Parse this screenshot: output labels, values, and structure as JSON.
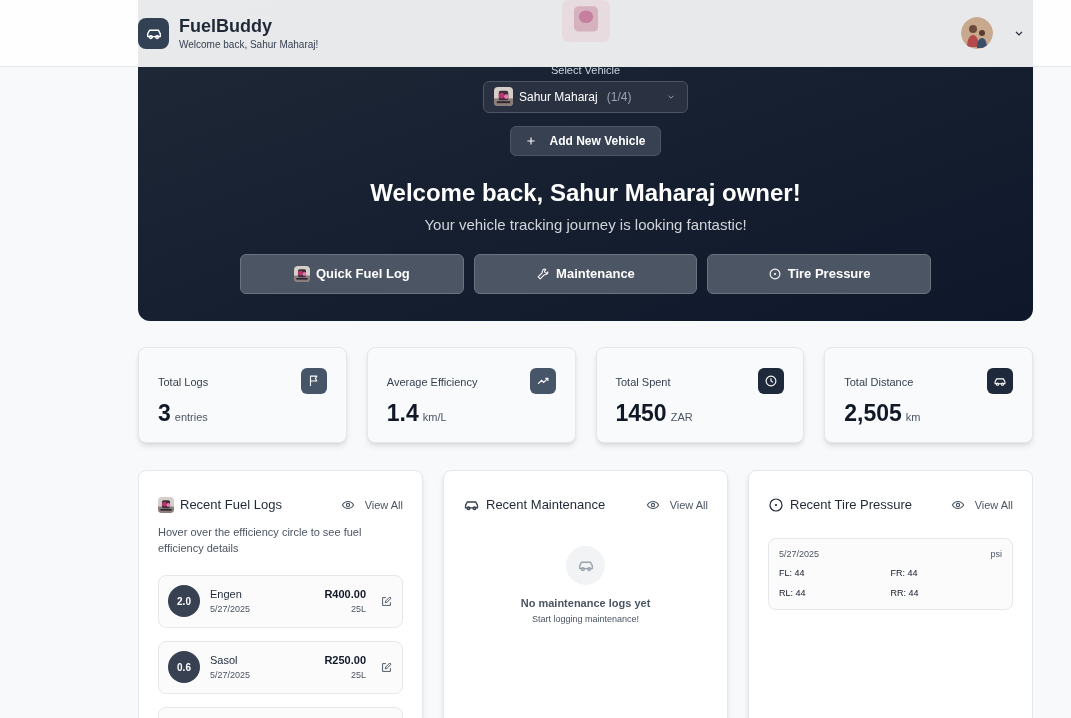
{
  "header": {
    "app_name": "FuelBuddy",
    "subtitle": "Welcome back, Sahur Maharaj!"
  },
  "vehicle_select": {
    "label": "Select Vehicle",
    "name": "Sahur Maharaj",
    "count": "(1/4)"
  },
  "add_vehicle_button": {
    "label": "Add New Vehicle"
  },
  "welcome": {
    "title": "Welcome back, Sahur Maharaj owner!",
    "subtitle": "Your vehicle tracking journey is looking fantastic!"
  },
  "quick_actions": [
    {
      "kind": "fuel",
      "label": "Quick Fuel Log"
    },
    {
      "kind": "maintenance",
      "label": "Maintenance"
    },
    {
      "kind": "tire",
      "label": "Tire Pressure"
    }
  ],
  "stats": [
    {
      "kind": "logs",
      "label": "Total Logs",
      "value": "3",
      "unit": "entries"
    },
    {
      "kind": "efficiency",
      "label": "Average Efficiency",
      "value": "1.4",
      "unit": "km/L"
    },
    {
      "kind": "spent",
      "label": "Total Spent",
      "value": "1450",
      "unit": "ZAR"
    },
    {
      "kind": "distance",
      "label": "Total Distance",
      "value": "2,505",
      "unit": "km"
    }
  ],
  "fuel_logs": {
    "title": "Recent Fuel Logs",
    "view_all": "View All",
    "hint": "Hover over the efficiency circle to see fuel efficiency details",
    "more_below": true,
    "entries": [
      {
        "efficiency": "2.0",
        "station": "Engen",
        "date": "5/27/2025",
        "amount": "R400.00",
        "volume": "25L"
      },
      {
        "efficiency": "0.6",
        "station": "Sasol",
        "date": "5/27/2025",
        "amount": "R250.00",
        "volume": "25L"
      }
    ]
  },
  "maintenance": {
    "title": "Recent Maintenance",
    "view_all": "View All",
    "empty_title": "No maintenance logs yet",
    "empty_hint": "Start logging maintenance!"
  },
  "tire_pressure": {
    "title": "Recent Tire Pressure",
    "view_all": "View All",
    "readings": [
      {
        "date": "5/27/2025",
        "unit": "psi",
        "values": [
          "FL: 44",
          "FR: 44",
          "RL: 44",
          "RR: 44"
        ]
      }
    ]
  }
}
